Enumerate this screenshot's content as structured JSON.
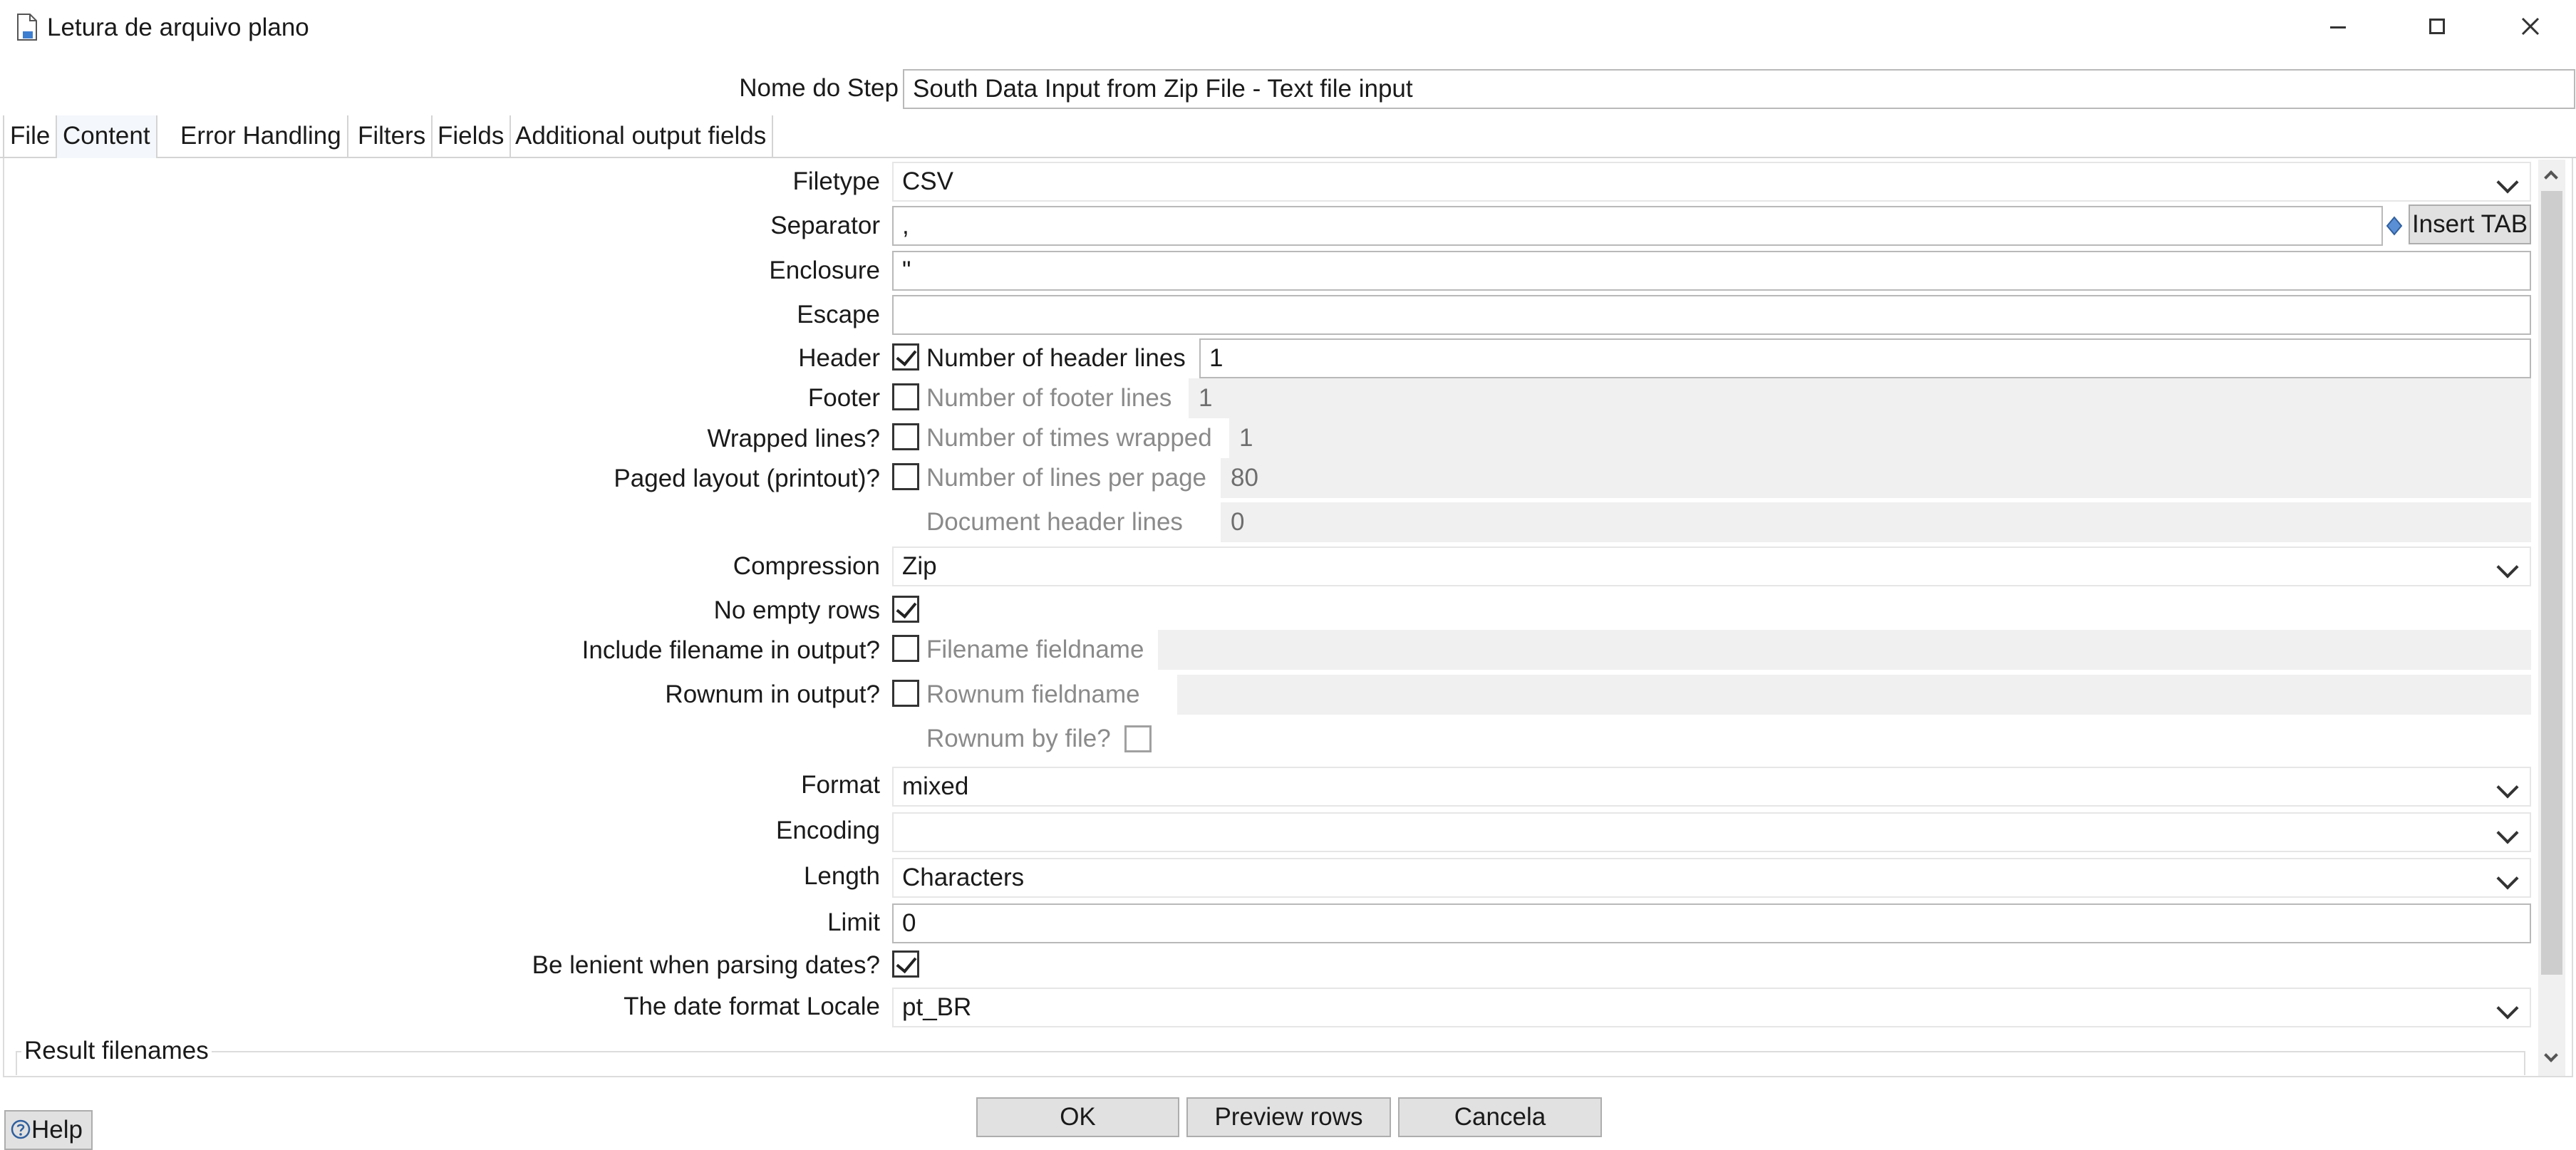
{
  "window": {
    "title": "Letura de arquivo plano",
    "controls": [
      "minimize-icon",
      "maximize-icon",
      "close-icon"
    ]
  },
  "step": {
    "label": "Nome do Step",
    "value": "South Data Input from Zip File - Text file input"
  },
  "tabs": [
    {
      "label": "File",
      "active": false
    },
    {
      "label": "Content",
      "active": true
    },
    {
      "label": "Error Handling",
      "active": false
    },
    {
      "label": "Filters",
      "active": false
    },
    {
      "label": "Fields",
      "active": false
    },
    {
      "label": "Additional output fields",
      "active": false
    }
  ],
  "content": {
    "filetype": {
      "label": "Filetype",
      "value": "CSV"
    },
    "separator": {
      "label": "Separator",
      "value": ",",
      "insert_tab": "Insert TAB"
    },
    "enclosure": {
      "label": "Enclosure",
      "value": "\""
    },
    "escape": {
      "label": "Escape",
      "value": ""
    },
    "header": {
      "label": "Header",
      "checked": true,
      "sub_label": "Number of header lines",
      "value": "1"
    },
    "footer": {
      "label": "Footer",
      "checked": false,
      "sub_label": "Number of footer lines",
      "value": "1"
    },
    "wrapped": {
      "label": "Wrapped lines?",
      "checked": false,
      "sub_label": "Number of times wrapped",
      "value": "1"
    },
    "paged": {
      "label": "Paged layout (printout)?",
      "checked": false,
      "sub_label": "Number of lines per page",
      "value": "80"
    },
    "doc_header": {
      "sub_label": "Document header lines",
      "value": "0"
    },
    "compression": {
      "label": "Compression",
      "value": "Zip"
    },
    "no_empty_rows": {
      "label": "No empty rows",
      "checked": true
    },
    "include_filename": {
      "label": "Include filename in output?",
      "checked": false,
      "sub_label": "Filename fieldname",
      "value": ""
    },
    "rownum": {
      "label": "Rownum in output?",
      "checked": false,
      "sub_label": "Rownum fieldname",
      "value": ""
    },
    "rownum_by_file": {
      "sub_label": "Rownum by file?",
      "checked": false
    },
    "format": {
      "label": "Format",
      "value": "mixed"
    },
    "encoding": {
      "label": "Encoding",
      "value": ""
    },
    "length": {
      "label": "Length",
      "value": "Characters"
    },
    "limit": {
      "label": "Limit",
      "value": "0"
    },
    "lenient": {
      "label": "Be lenient when parsing dates?",
      "checked": true
    },
    "locale": {
      "label": "The date format Locale",
      "value": "pt_BR"
    },
    "result_filenames": "Result filenames"
  },
  "buttons": {
    "ok": "OK",
    "preview": "Preview rows",
    "cancel": "Cancela",
    "help": "Help"
  }
}
